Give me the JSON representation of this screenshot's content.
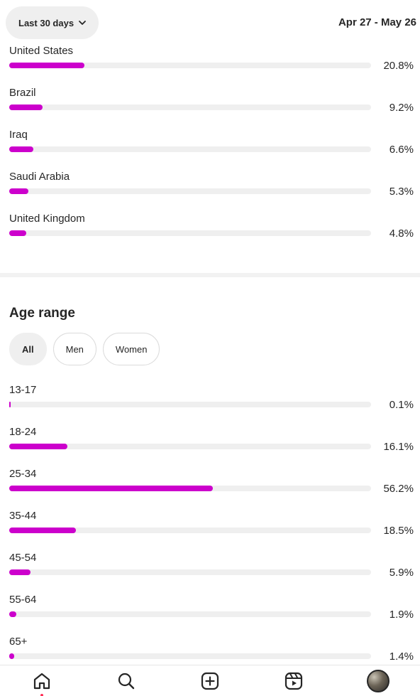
{
  "header": {
    "range_label": "Last 30 days",
    "date_range": "Apr 27 - May 26"
  },
  "countries": [
    {
      "label": "United States",
      "pct_text": "20.8%",
      "value": 20.8
    },
    {
      "label": "Brazil",
      "pct_text": "9.2%",
      "value": 9.2
    },
    {
      "label": "Iraq",
      "pct_text": "6.6%",
      "value": 6.6
    },
    {
      "label": "Saudi Arabia",
      "pct_text": "5.3%",
      "value": 5.3
    },
    {
      "label": "United Kingdom",
      "pct_text": "4.8%",
      "value": 4.8
    }
  ],
  "age_section": {
    "title": "Age range",
    "filters": [
      "All",
      "Men",
      "Women"
    ],
    "selected_filter": "All",
    "rows": [
      {
        "label": "13-17",
        "pct_text": "0.1%",
        "value": 0.1
      },
      {
        "label": "18-24",
        "pct_text": "16.1%",
        "value": 16.1
      },
      {
        "label": "25-34",
        "pct_text": "56.2%",
        "value": 56.2
      },
      {
        "label": "35-44",
        "pct_text": "18.5%",
        "value": 18.5
      },
      {
        "label": "45-54",
        "pct_text": "5.9%",
        "value": 5.9
      },
      {
        "label": "55-64",
        "pct_text": "1.9%",
        "value": 1.9
      },
      {
        "label": "65+",
        "pct_text": "1.4%",
        "value": 1.4
      }
    ]
  },
  "colors": {
    "bar_fill": "#cc00cc",
    "bar_track": "#efefef",
    "notification_dot": "#ff2d55"
  },
  "nav": {
    "items": [
      "home-icon",
      "search-icon",
      "create-icon",
      "reels-icon",
      "profile-avatar"
    ]
  }
}
